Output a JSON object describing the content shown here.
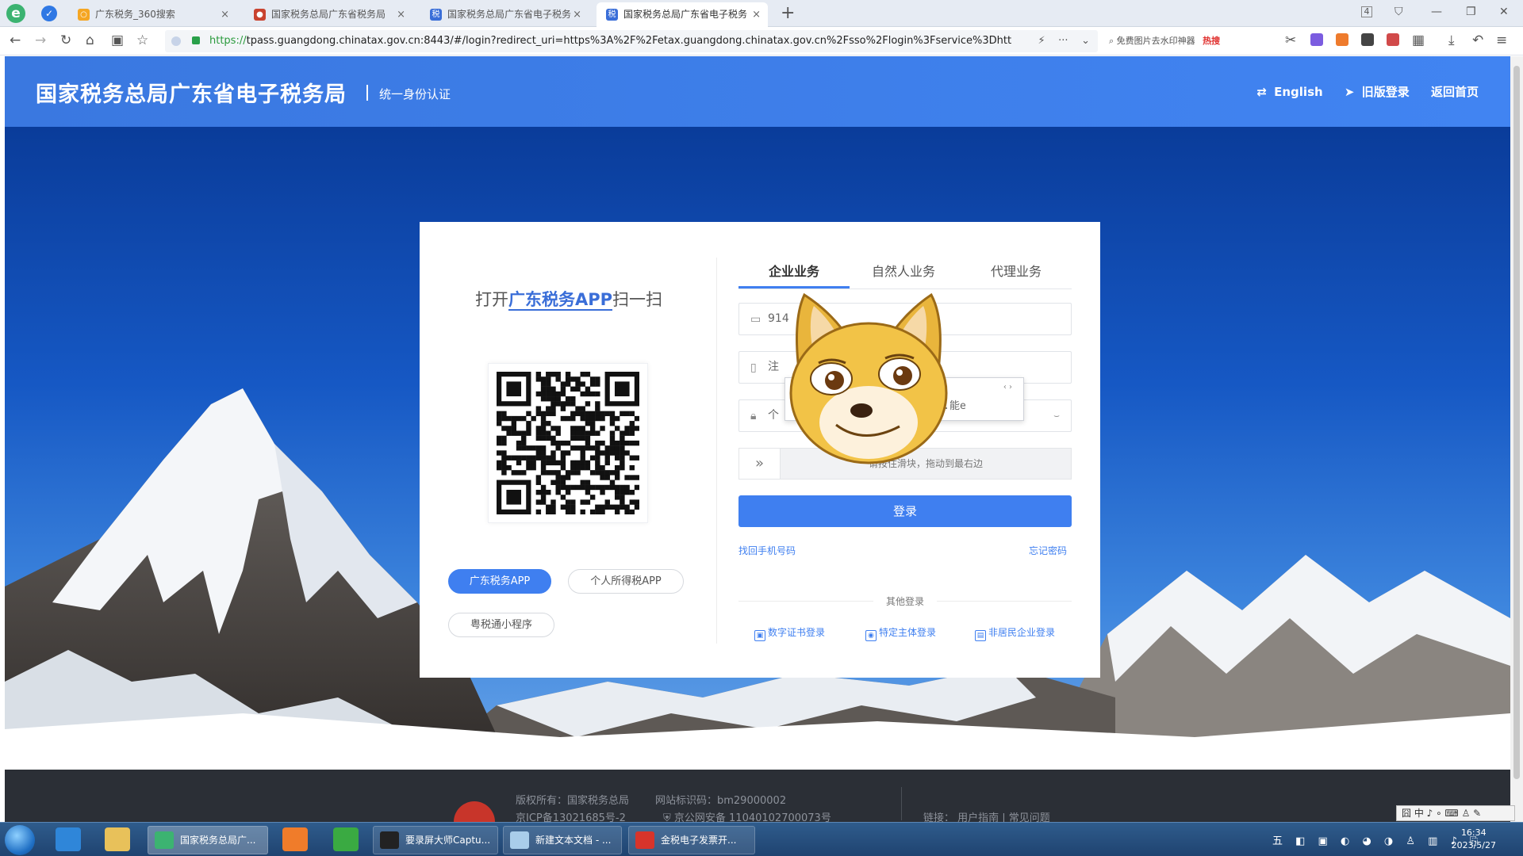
{
  "browser": {
    "tabs": [
      {
        "label": "广东税务_360搜索",
        "color": "#f5a623"
      },
      {
        "label": "国家税务总局广东省税务局",
        "color": "#c9432f"
      },
      {
        "label": "国家税务总局广东省电子税务",
        "color": "#3a6ed8"
      },
      {
        "label": "国家税务总局广东省电子税务",
        "color": "#3a6ed8"
      }
    ],
    "new_tab": "+",
    "close_glyph": "×",
    "tab_count": "4",
    "url_scheme": "https://",
    "url_rest": "tpass.guangdong.chinatax.gov.cn:8443/#/login?redirect_uri=https%3A%2F%2Fetax.guangdong.chinatax.gov.cn%2Fsso%2Flogin%3Fservice%3Dhtt",
    "search_hint": "免费图片去水印神器",
    "hot_label": "热搜"
  },
  "header": {
    "title": "国家税务总局广东省电子税务局",
    "subtitle": "统一身份认证",
    "english": "English",
    "old_login": "旧版登录",
    "home": "返回首页"
  },
  "login": {
    "qr_prefix": "打开",
    "qr_app": "广东税务APP",
    "qr_suffix": "扫一扫",
    "app_buttons": [
      "广东税务APP",
      "个人所得税APP",
      "粤税通小程序"
    ],
    "tabs": [
      "企业业务",
      "自然人业务",
      "代理业务"
    ],
    "field_taxid": "914",
    "field_account": "注",
    "field_password": "个",
    "popup_text": "efp 5.能e",
    "slider_text": "请按住滑块，拖动到最右边",
    "login_button": "登录",
    "link_phone": "找回手机号码",
    "link_forgot": "忘记密码",
    "other_label": "其他登录",
    "alt_logins": [
      "数字证书登录",
      "特定主体登录",
      "非居民企业登录"
    ]
  },
  "footer": {
    "copyright": "版权所有：国家税务总局",
    "site_code": "网站标识码：bm29000002",
    "icp": "京ICP备13021685号-2",
    "police": "京公网安备 11040102700073号",
    "links": "链接：  用户指南   |   常见问题"
  },
  "taskbar": {
    "items": [
      "国家税务总局广...",
      "要录屏大师Captu...",
      "新建文本文档 - ...",
      "金税电子发票开..."
    ],
    "time": "16:34",
    "date": "2023/5/27",
    "ime": "囧 中 ♪ ∘ ⌨ ♙ ✎"
  },
  "colors": {
    "primary": "#3f7ff0",
    "header_blue": "#4184f2",
    "footer_bg": "#2b2f36"
  }
}
